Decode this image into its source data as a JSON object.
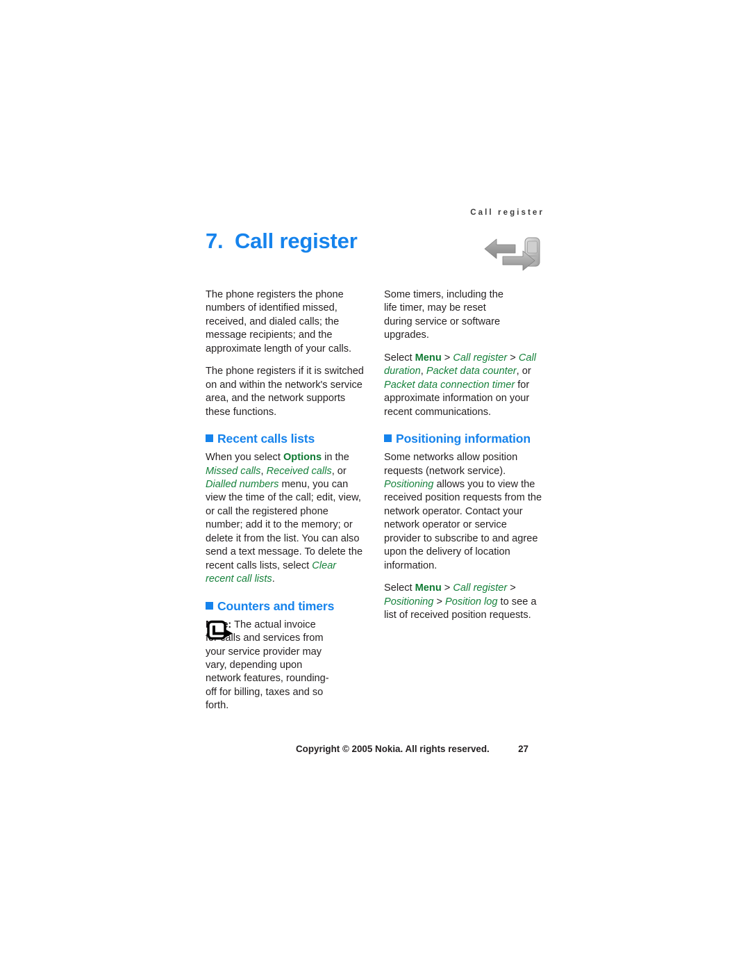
{
  "page": {
    "running_header": "Call register",
    "chapter_number": "7.",
    "chapter_title": "Call register",
    "chapter_icon": "call-register-arrows-icon"
  },
  "left_column": {
    "para1": "The phone registers the phone numbers of identified missed, received, and dialed calls; the message recipients; and the approximate length of your calls.",
    "para2": "The phone registers if it is switched on and within the network's service area, and the network supports these functions.",
    "section1": {
      "heading": "Recent calls lists",
      "body": {
        "t1": "When you select ",
        "ui1": "Options",
        "t2": " in the ",
        "ui2": "Missed calls",
        "t3": ", ",
        "ui3": "Received calls",
        "t4": ", or ",
        "ui4": "Dialled numbers",
        "t5": " menu, you can view the time of the call; edit, view, or call the registered phone number; add it to the memory; or delete it from the list. You can also send a text message. To delete the recent calls lists, select ",
        "ui5": "Clear recent call lists",
        "t6": "."
      }
    },
    "section2": {
      "heading": "Counters and timers",
      "note_icon": "note-arrow-icon",
      "note_label": "Note:",
      "note_text": " The actual invoice for calls and services from your service provider may vary, depending upon network features, rounding-off for billing, taxes and so forth."
    }
  },
  "right_column": {
    "para1": "Some timers, including the life timer, may be reset during service or software upgrades.",
    "para2": {
      "t1": "Select ",
      "ui1": "Menu",
      "t2": " > ",
      "ui2": "Call register",
      "t3": " > ",
      "ui3": "Call duration",
      "t4": ", ",
      "ui4": "Packet data counter",
      "t5": ", or ",
      "ui5": "Packet data connection timer",
      "t6": " for approximate information on your recent communications."
    },
    "section1": {
      "heading": "Positioning information",
      "body": {
        "t1": "Some networks allow position requests (network service). ",
        "ui1": "Positioning",
        "t2": " allows you to view the received position requests from the network operator. Contact your network operator or service provider to subscribe to and agree upon the delivery of location information."
      },
      "para_select": {
        "t1": "Select ",
        "ui1": "Menu",
        "t2": " > ",
        "ui2": "Call register",
        "t3": " > ",
        "ui3": "Positioning",
        "t4": " > ",
        "ui4": "Position log",
        "t5": " to see a list of received position requests."
      }
    }
  },
  "footer": {
    "copyright": "Copyright © 2005 Nokia. All rights reserved.",
    "page_number": "27"
  },
  "colors": {
    "heading_blue": "#1683ec",
    "ui_green": "#17823c",
    "body_black": "#231f20"
  }
}
